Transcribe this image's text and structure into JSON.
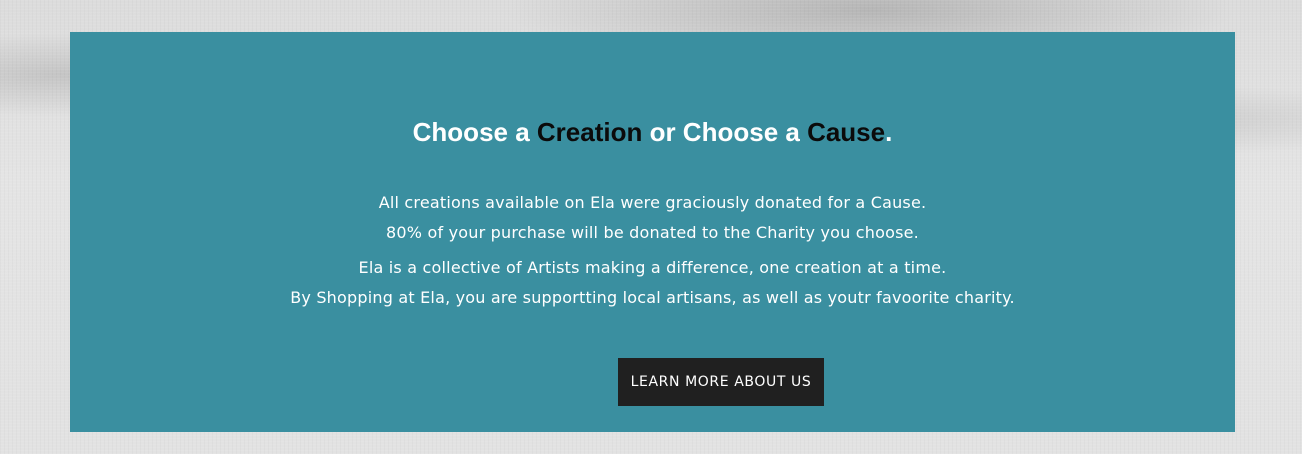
{
  "section": {
    "headline": {
      "part1": "Choose a ",
      "accent1": "Creation",
      "part2": " or Choose a ",
      "accent2": "Cause",
      "part3": "."
    },
    "paragraph_lines": [
      "All creations available on Ela were graciously donated for a Cause.",
      "80% of your purchase will be donated to the Charity you choose.",
      "Ela is a collective of Artists making a difference, one creation at a time.",
      "By Shopping at Ela, you are supportting local artisans, as well as youtr favoorite charity."
    ],
    "cta_label": "LEARN MORE ABOUT US"
  },
  "colors": {
    "panel_background": "#3a8fa0",
    "accent_text": "#0b0b0b",
    "button_background": "#202020",
    "text": "#ffffff"
  }
}
